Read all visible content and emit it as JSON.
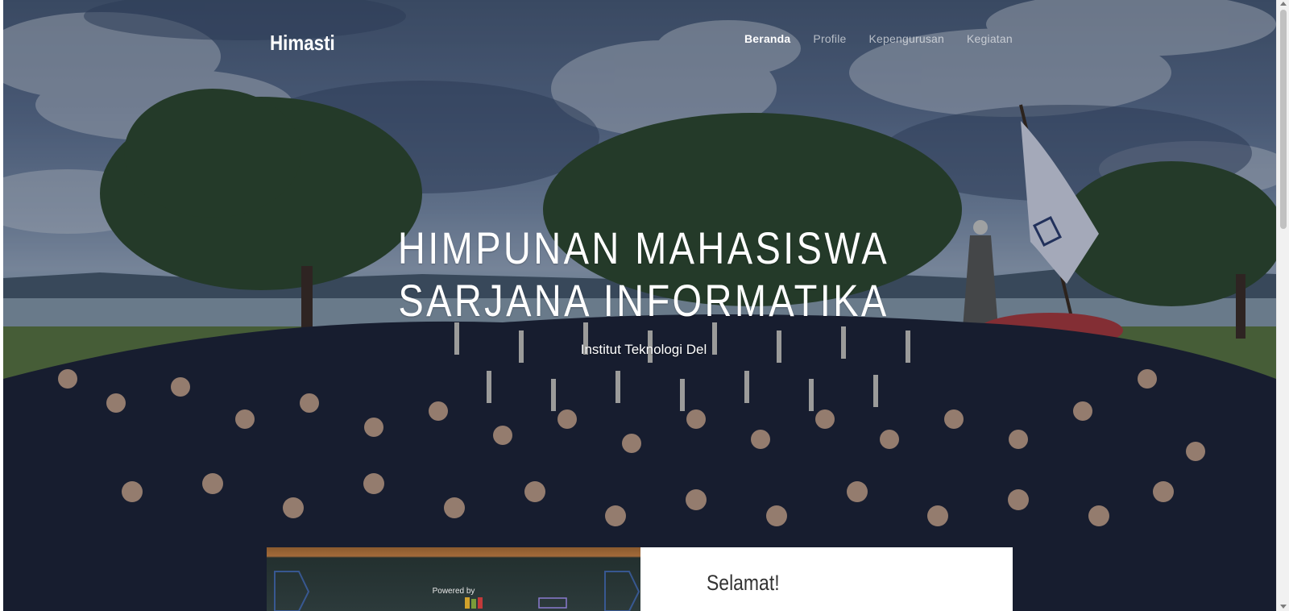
{
  "navbar": {
    "brand": "Himasti",
    "links": [
      {
        "label": "Beranda",
        "active": true
      },
      {
        "label": "Profile",
        "active": false
      },
      {
        "label": "Kepengurusan",
        "active": false
      },
      {
        "label": "Kegiatan",
        "active": false
      }
    ]
  },
  "hero": {
    "title_line1": "HIMPUNAN MAHASISWA",
    "title_line2": "SARJANA INFORMATIKA",
    "subtitle": "Institut Teknologi Del"
  },
  "feature": {
    "image_caption": "Powered by",
    "heading": "Selamat!"
  },
  "colors": {
    "nav_active": "#ffffff",
    "nav_inactive": "#ffffff9e",
    "card_background": "#ffffff",
    "heading_text": "#333333"
  },
  "icons": [
    "flag-icon"
  ]
}
